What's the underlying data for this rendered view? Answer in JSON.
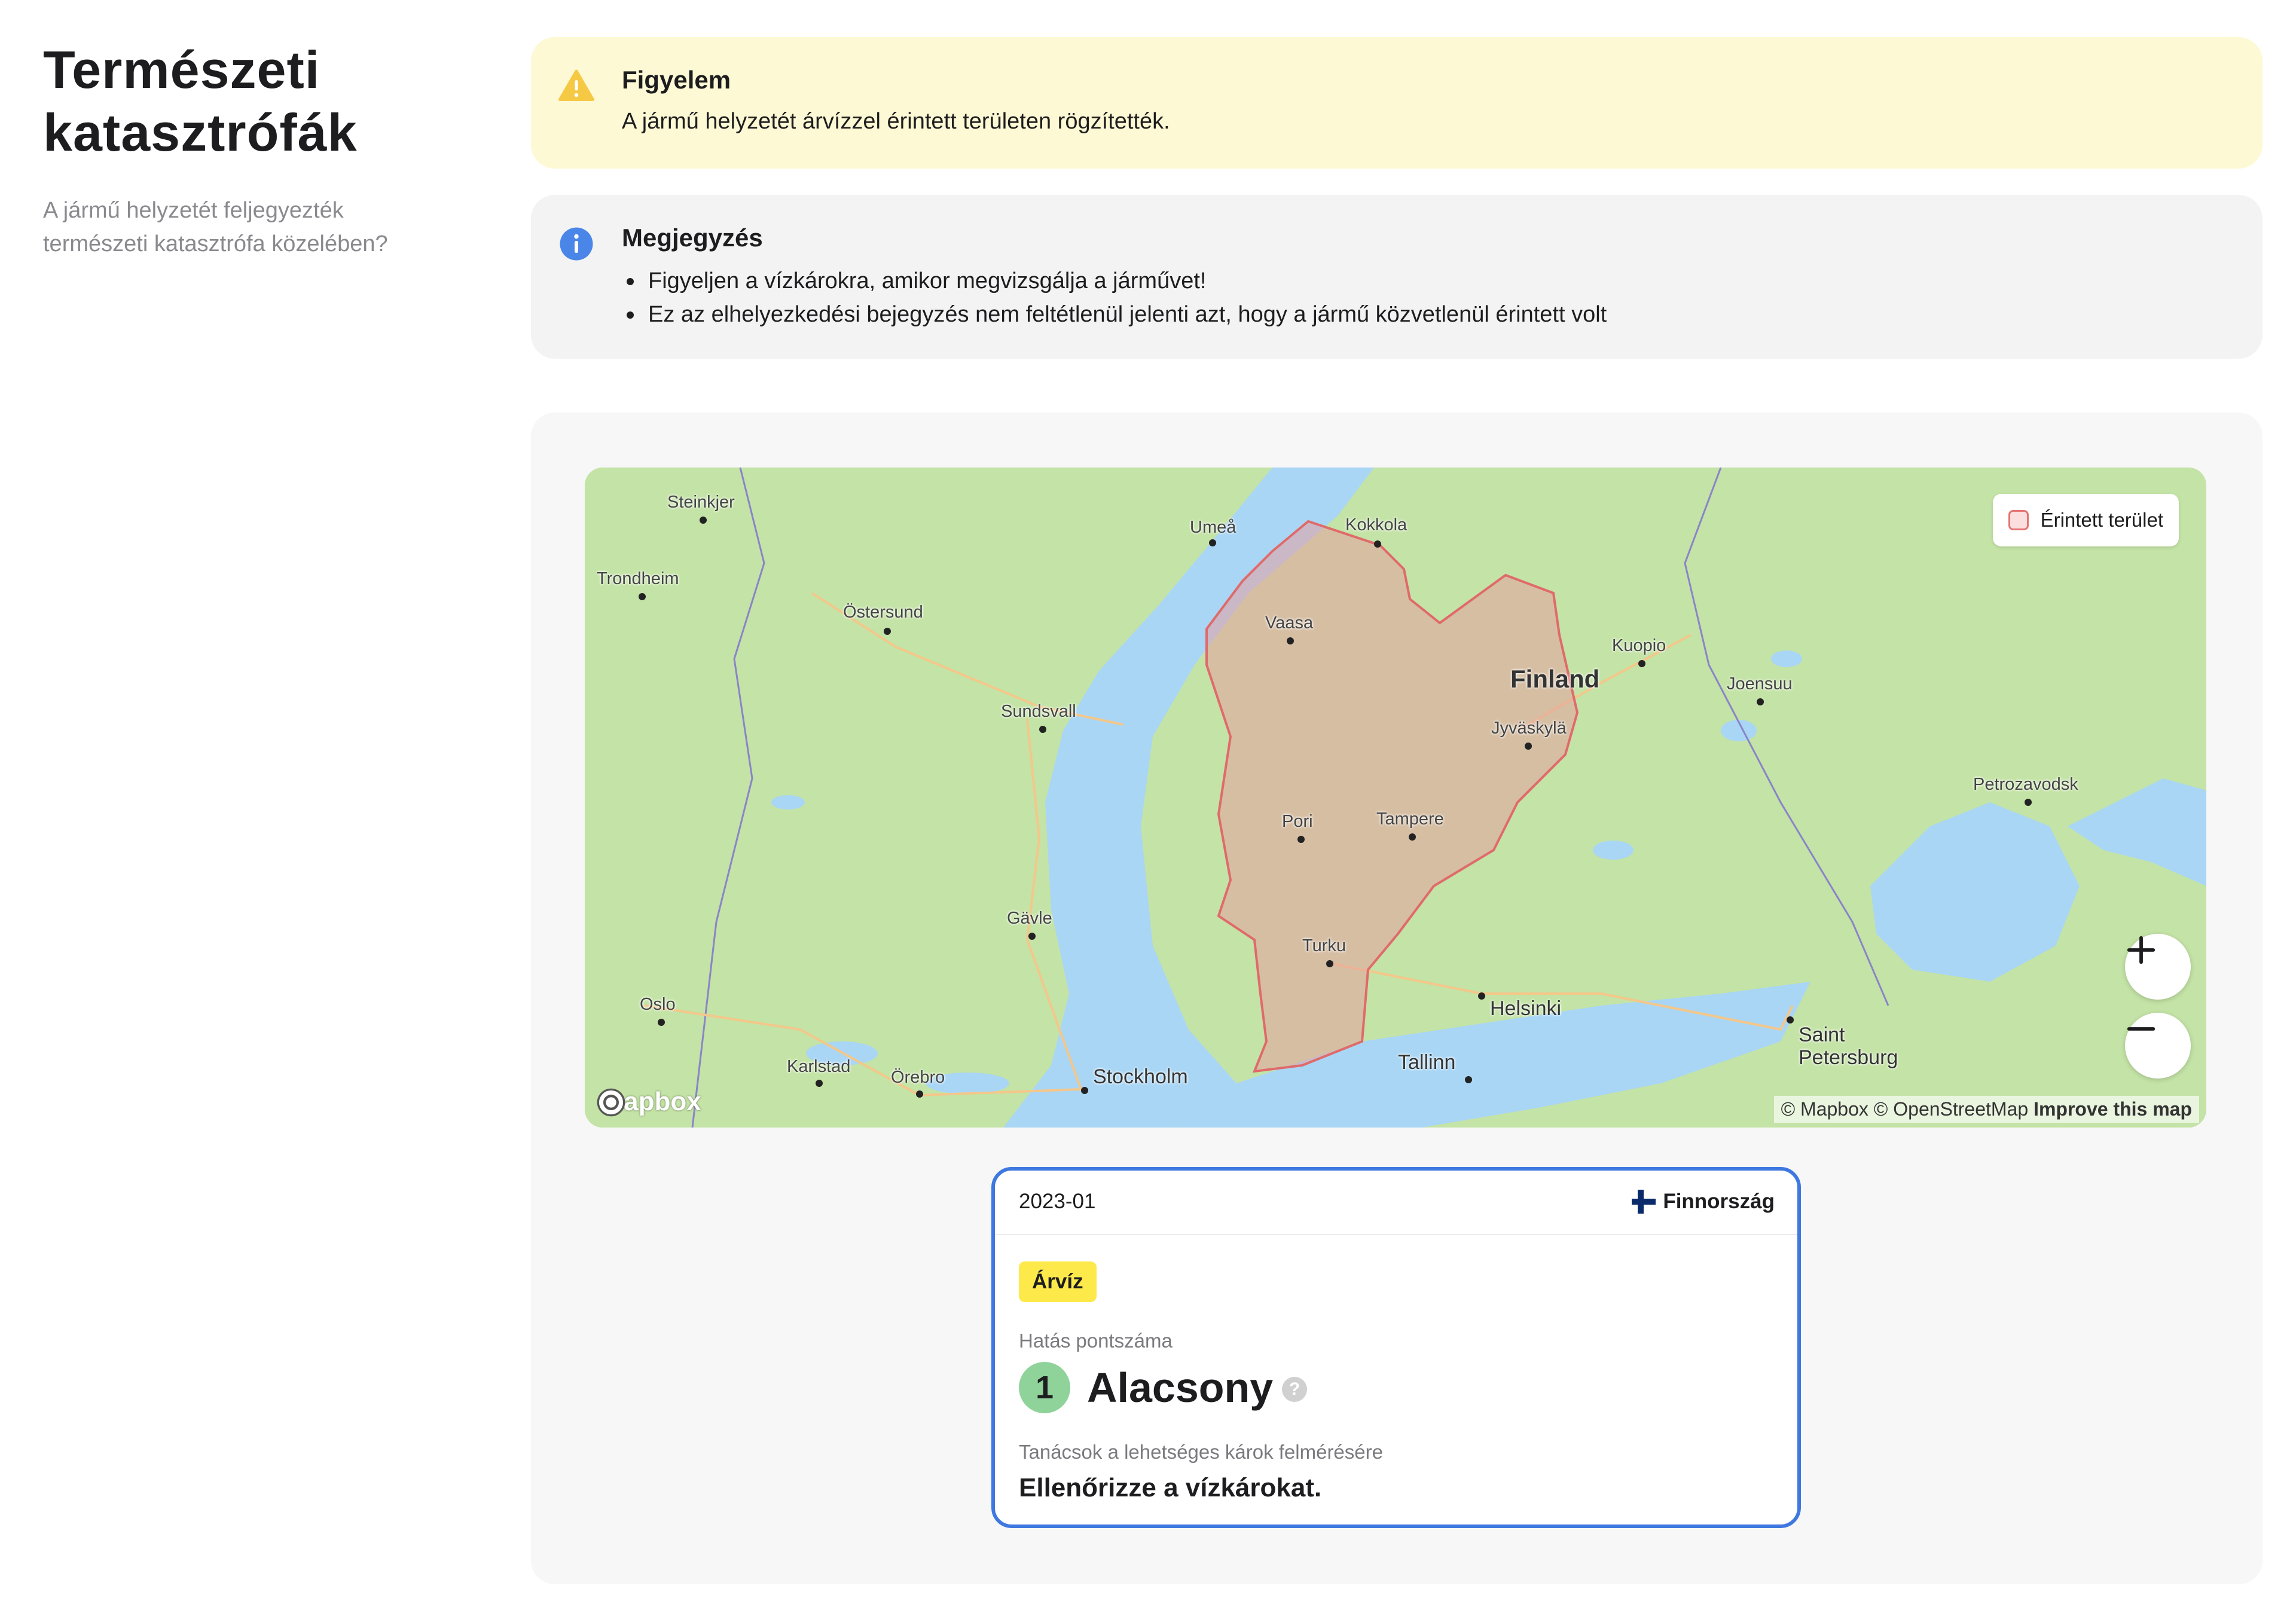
{
  "page": {
    "title_line1": "Természeti",
    "title_line2": "katasztrófák",
    "subtitle_line1": "A jármű helyzetét feljegyezték",
    "subtitle_line2": "természeti katasztrófa közelében?"
  },
  "warning": {
    "icon": "warning-icon",
    "title": "Figyelem",
    "text": "A jármű helyzetét árvízzel érintett területen rögzítették."
  },
  "note": {
    "icon": "info-icon",
    "title": "Megjegyzés",
    "items": [
      "Figyeljen a vízkárokra, amikor megvizsgálja a járművet!",
      "Ez az elhelyezkedési bejegyzés nem feltétlenül jelenti azt, hogy a jármű közvetlenül érintett volt"
    ]
  },
  "map": {
    "legend_label": "Érintett terület",
    "attribution": "© Mapbox © OpenStreetMap",
    "improve_link": "Improve this map",
    "logo_text": "mapbox",
    "country_label": "Finland",
    "cities": {
      "steinkjer": "Steinkjer",
      "trondheim": "Trondheim",
      "ostersund": "Östersund",
      "umea": "Umeå",
      "kokkola": "Kokkola",
      "vaasa": "Vaasa",
      "sundsvall": "Sundsvall",
      "kuopio": "Kuopio",
      "joensuu": "Joensuu",
      "jyvaskyla": "Jyväskylä",
      "pori": "Pori",
      "tampere": "Tampere",
      "petrozavodsk": "Petrozavodsk",
      "gavle": "Gävle",
      "turku": "Turku",
      "oslo": "Oslo",
      "helsinki": "Helsinki",
      "karlstad": "Karlstad",
      "orebro": "Örebro",
      "stockholm": "Stockholm",
      "tallinn": "Tallinn",
      "saint": "Saint",
      "petersburg": "Petersburg"
    },
    "colors": {
      "water": "#a9d6f5",
      "land": "#c4e3a6",
      "affected_fill": "#e6a0a0",
      "affected_stroke": "#e06a6a"
    }
  },
  "card": {
    "date": "2023-01",
    "country": "Finnország",
    "flag_icon": "finland-flag-icon",
    "badge": "Árvíz",
    "impact_label": "Hatás pontszáma",
    "impact_score": "1",
    "impact_level": "Alacsony",
    "help_icon": "?",
    "advice_label": "Tanácsok a lehetséges károk felmérésére",
    "advice_text": "Ellenőrizze a vízkárokat."
  }
}
